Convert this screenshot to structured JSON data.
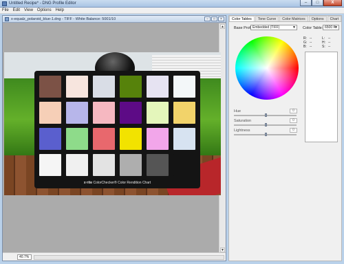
{
  "app": {
    "title": "Untitled Recipe* - DNG Profile Editor",
    "window_buttons": [
      "–",
      "□",
      "X"
    ]
  },
  "menu": [
    "File",
    "Edit",
    "View",
    "Options",
    "Help"
  ],
  "image_window": {
    "title": "x-equalz_polaroid_blue-1.dng - TIFF - White Balance: 5001/10",
    "zoom": "40.7%",
    "buttons": [
      "–",
      "□",
      "×"
    ]
  },
  "colorchecker": {
    "brand": "x·rite",
    "label": "ColorChecker® Color Rendition Chart",
    "patches": [
      "#7c5246",
      "#f7e5de",
      "#d9dde6",
      "#56820b",
      "#e6e3f2",
      "#f3f7f9",
      "#f6cfb7",
      "#b7b6ea",
      "#f6b8c1",
      "#5d0b86",
      "#e4f6bb",
      "#f2d36a",
      "#5a5fce",
      "#8edb8a",
      "#e8686d",
      "#f2e300",
      "#f2a6ea",
      "#d7e3f1",
      "#f5f5f5",
      "#f0f0f0",
      "#e3e3e3",
      "#aeaeae",
      "#555555",
      "#141414"
    ]
  },
  "panel": {
    "tabs": [
      "Color Tables",
      "Tone Curve",
      "Color Matrices",
      "Options",
      "Chart"
    ],
    "active_tab": "Color Tables",
    "base_profile_label": "Base Profile:",
    "base_profile_value": "Embedded (TIFF)",
    "color_table_label": "Color Table:",
    "color_table_value": "6500 K",
    "readouts": {
      "rows": [
        {
          "a": "R:",
          "b": "--",
          "c": "L:",
          "d": "--"
        },
        {
          "a": "G:",
          "b": "--",
          "c": "H:",
          "d": "--"
        },
        {
          "a": "B:",
          "b": "--",
          "c": "S:",
          "d": "--"
        }
      ]
    },
    "sliders": [
      {
        "label": "Hue",
        "value": "0"
      },
      {
        "label": "Saturation",
        "value": "0"
      },
      {
        "label": "Lightness",
        "value": "0"
      }
    ]
  }
}
